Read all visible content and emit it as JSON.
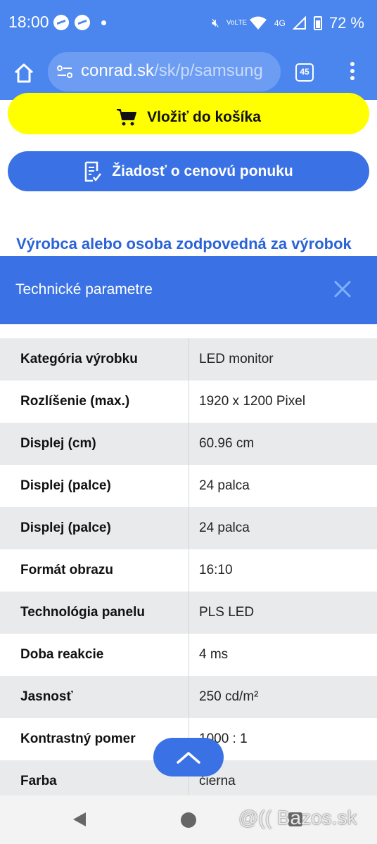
{
  "status_bar": {
    "time": "18:00",
    "battery_percent": "72 %",
    "network": "4G",
    "volte": "VoLTE"
  },
  "browser": {
    "url_domain": "conrad.sk",
    "url_path": "/sk/p/samsung",
    "tab_count": "45"
  },
  "actions": {
    "cart_label": "Vložiť do košíka",
    "quote_label": "Žiadosť o cenovú ponuku"
  },
  "manufacturer_link": "Výrobca alebo osoba zodpovedná za výrobok",
  "tech_section": {
    "title": "Technické parametre"
  },
  "specs": [
    {
      "key": "Kategória výrobku",
      "value": "LED monitor"
    },
    {
      "key": "Rozlíšenie (max.)",
      "value": "1920 x 1200 Pixel"
    },
    {
      "key": "Displej (cm)",
      "value": "60.96 cm"
    },
    {
      "key": "Displej (palce)",
      "value": "24 palca"
    },
    {
      "key": "Displej (palce)",
      "value": "24 palca"
    },
    {
      "key": "Formát obrazu",
      "value": "16:10"
    },
    {
      "key": "Technológia panelu",
      "value": "PLS LED"
    },
    {
      "key": "Doba reakcie",
      "value": "4 ms"
    },
    {
      "key": "Jasnosť",
      "value": "250 cd/m²"
    },
    {
      "key": "Kontrastný pomer",
      "value": "1000 : 1"
    },
    {
      "key": "Farba",
      "value": "čierna"
    }
  ],
  "watermark": "@(( Bazos.sk",
  "colors": {
    "header_blue": "#4a86ee",
    "button_blue": "#3a72e5",
    "cart_yellow": "#ffff00",
    "link_blue": "#2a63d6"
  }
}
